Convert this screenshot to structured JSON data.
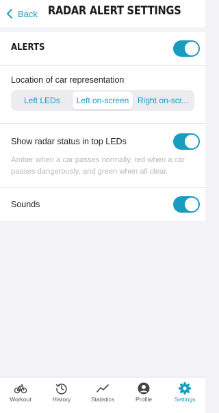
{
  "header": {
    "back_label": "Back",
    "title": "RADAR ALERT SETTINGS"
  },
  "alerts": {
    "label": "ALERTS",
    "enabled": true
  },
  "car_representation": {
    "label": "Location of car representation",
    "options": [
      "Left LEDs",
      "Left on-screen",
      "Right on-scr..."
    ],
    "selected": "Left on-screen"
  },
  "radar_status": {
    "label": "Show radar status in top LEDs",
    "enabled": true,
    "description": "Amber when a car passes normally, red when a car passes dangerously, and green when all clear."
  },
  "sounds": {
    "label": "Sounds",
    "enabled": true
  },
  "tabbar": {
    "tabs": [
      {
        "label": "Workout",
        "icon": "bike-icon"
      },
      {
        "label": "History",
        "icon": "history-icon"
      },
      {
        "label": "Statistics",
        "icon": "statistics-icon"
      },
      {
        "label": "Profile",
        "icon": "profile-icon"
      },
      {
        "label": "Settings",
        "icon": "gear-icon"
      }
    ],
    "active": "Settings"
  },
  "colors": {
    "accent": "#1a9bc0",
    "background": "#f2f2f7",
    "secondary_text": "#b8b8be"
  }
}
